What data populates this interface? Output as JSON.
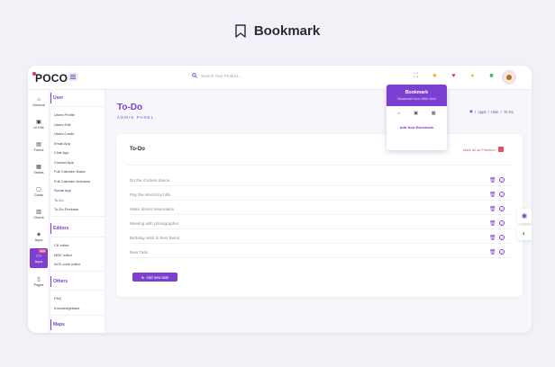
{
  "hero": {
    "title": "Bookmark",
    "icon": "bookmark-icon"
  },
  "app": {
    "logo": "POCO"
  },
  "search": {
    "placeholder": "Search Your Product..."
  },
  "rail": [
    {
      "label": "General",
      "icon": "home-icon"
    },
    {
      "label": "UI Kits",
      "icon": "briefcase-icon"
    },
    {
      "label": "Forms",
      "icon": "clipboard-icon"
    },
    {
      "label": "Tables",
      "icon": "table-icon"
    },
    {
      "label": "Cards",
      "icon": "calendar-icon"
    },
    {
      "label": "Charts",
      "icon": "bar-chart-icon"
    },
    {
      "label": "Apps",
      "icon": "layers-icon"
    },
    {
      "label": "Apps",
      "icon": "folder-icon",
      "badge": "New"
    },
    {
      "label": "Pages",
      "icon": "file-icon"
    }
  ],
  "submenu": {
    "user_title": "User",
    "user_links": [
      "Users Profile",
      "Users Edit",
      "Users Cards",
      "Email App",
      "Chat App",
      "Contact App",
      "Full Calender Basic",
      "Full Calender Advance",
      "Social App",
      "To-Do",
      "To-Do Firebase"
    ],
    "editors_title": "Editors",
    "editors_links": [
      "CK editor",
      "MDE editor",
      "ACE code editor"
    ],
    "others_title": "Others",
    "others_links": [
      "FAQ",
      "Knowledgebase"
    ],
    "maps_title": "Maps"
  },
  "page": {
    "title": "To-Do",
    "subtitle": "ADMIN PANEL",
    "breadcrumb": [
      "Apps",
      "User",
      "To-Do"
    ]
  },
  "todo": {
    "card_title": "To-Do",
    "mark_all_label": "Mark all as Finished",
    "tasks": [
      "Do the chicken dance",
      "Pay the electricity bills",
      "Make dinner reservation",
      "Meeting with photographer",
      "Birthday wish to best friend",
      "New Task"
    ],
    "add_label": "Add new task"
  },
  "bookmark_popup": {
    "title": "Bookmark",
    "subtitle": "Bookmark Icon With Grid",
    "add_label": "Add New Bookmark"
  },
  "colors": {
    "accent": "#7c3fd1",
    "danger": "#ee4e57"
  }
}
